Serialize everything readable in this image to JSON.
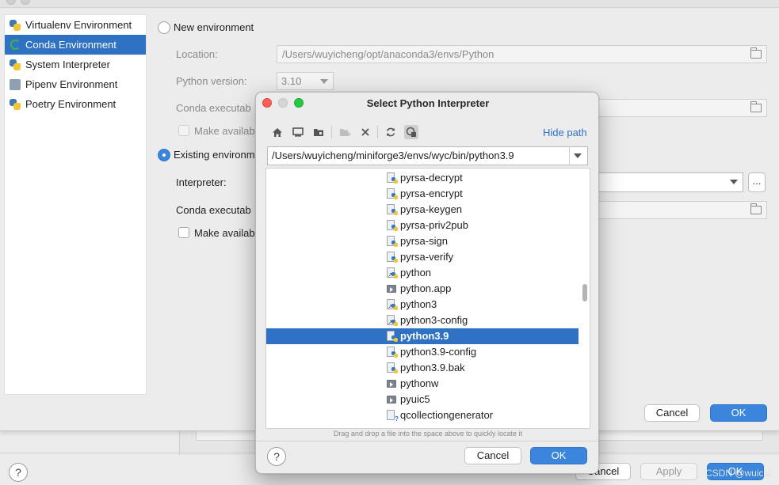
{
  "settings_footer": {
    "help": "?",
    "cancel_label": "Cancel",
    "apply_label": "Apply",
    "ok_label": "OK"
  },
  "add_interpreter": {
    "env_types": [
      {
        "label": "Virtualenv Environment",
        "icon": "python-icon"
      },
      {
        "label": "Conda Environment",
        "icon": "conda-icon"
      },
      {
        "label": "System Interpreter",
        "icon": "python-icon"
      },
      {
        "label": "Pipenv Environment",
        "icon": "pipenv-icon"
      },
      {
        "label": "Poetry Environment",
        "icon": "python-icon"
      }
    ],
    "selected_env_type": "Conda Environment",
    "new_env": {
      "radio_label": "New environment",
      "location_label": "Location:",
      "location_value": "/Users/wuyicheng/opt/anaconda3/envs/Python",
      "python_version_label": "Python version:",
      "python_version_value": "3.10",
      "conda_exec_label": "Conda executab",
      "make_available_label": "Make availab"
    },
    "existing_env": {
      "radio_label": "Existing environm",
      "interpreter_label": "Interpreter:",
      "conda_exec_label": "Conda executab",
      "make_available_label": "Make availab",
      "browse_label": "..."
    },
    "cancel_label": "Cancel",
    "ok_label": "OK"
  },
  "file_chooser": {
    "title": "Select Python Interpreter",
    "toolbar_icons": [
      "home-icon",
      "desktop-icon",
      "project-folder-icon",
      "new-folder-icon",
      "delete-icon",
      "refresh-icon",
      "show-hidden-icon"
    ],
    "hide_path_label": "Hide path",
    "path_value": "/Users/wuyicheng/miniforge3/envs/wyc/bin/python3.9",
    "files": [
      {
        "name": "pyrsa-decrypt",
        "kind": "python-script"
      },
      {
        "name": "pyrsa-encrypt",
        "kind": "python-script"
      },
      {
        "name": "pyrsa-keygen",
        "kind": "python-script"
      },
      {
        "name": "pyrsa-priv2pub",
        "kind": "python-script"
      },
      {
        "name": "pyrsa-sign",
        "kind": "python-script"
      },
      {
        "name": "pyrsa-verify",
        "kind": "python-script"
      },
      {
        "name": "python",
        "kind": "python-link"
      },
      {
        "name": "python.app",
        "kind": "executable"
      },
      {
        "name": "python3",
        "kind": "python-link"
      },
      {
        "name": "python3-config",
        "kind": "python-link"
      },
      {
        "name": "python3.9",
        "kind": "python-binary"
      },
      {
        "name": "python3.9-config",
        "kind": "python-script"
      },
      {
        "name": "python3.9.bak",
        "kind": "python-script"
      },
      {
        "name": "pythonw",
        "kind": "executable"
      },
      {
        "name": "pyuic5",
        "kind": "executable"
      },
      {
        "name": "qcollectiongenerator",
        "kind": "unknown"
      }
    ],
    "selected_file": "python3.9",
    "drag_hint": "Drag and drop a file into the space above to quickly locate it",
    "help": "?",
    "cancel_label": "Cancel",
    "ok_label": "OK"
  },
  "watermark": "CSDN @wuicer",
  "colors": {
    "selection": "#2f72c4",
    "primary_button": "#3b86dc",
    "link": "#2f72c4",
    "close_light": "#fe5f57",
    "zoom_light": "#28c840"
  }
}
